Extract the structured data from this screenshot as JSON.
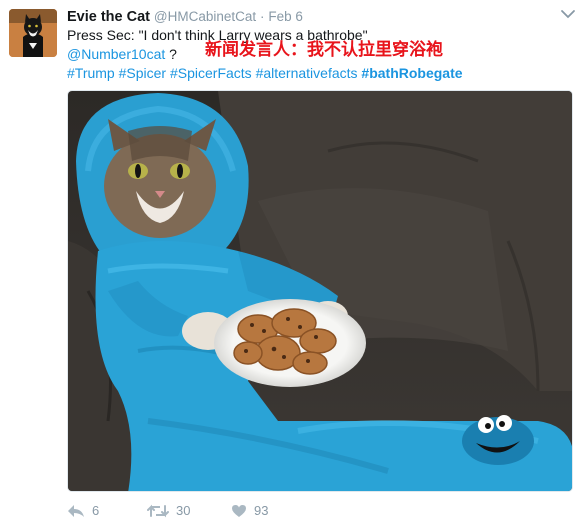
{
  "tweet": {
    "display_name": "Evie the Cat",
    "handle": "@HMCabinetCat",
    "separator": "·",
    "date": "Feb 6",
    "text_line1": "Press Sec: \"I don't think Larry wears a bathrobe\"",
    "mention": "@Number10cat",
    "question": " ?",
    "overlay_text": "新闻发言人：我不认拉里穿浴袍",
    "hashtags": [
      "#Trump",
      "#Spicer",
      "#SpicerFacts",
      "#alternativefacts"
    ],
    "hashtag_bold": "#bathRobegate"
  },
  "actions": {
    "reply_count": "6",
    "retweet_count": "30",
    "like_count": "93"
  },
  "colors": {
    "link": "#1b95e0",
    "muted": "#8899a6",
    "overlay_red": "#e8141b"
  },
  "icons": [
    "chevron-down-icon",
    "reply-icon",
    "retweet-icon",
    "heart-icon"
  ]
}
